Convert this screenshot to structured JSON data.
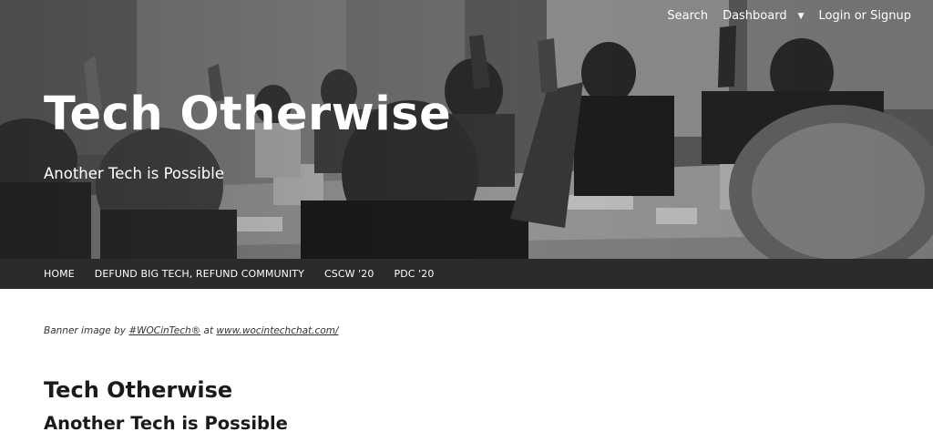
{
  "top_nav": {
    "search_label": "Search",
    "dashboard_label": "Dashboard",
    "login_label": "Login or Signup"
  },
  "header": {
    "site_title": "Tech Otherwise",
    "tagline": "Another Tech is Possible"
  },
  "main_menu": {
    "items": [
      {
        "label": "HOME"
      },
      {
        "label": "DEFUND BIG TECH, REFUND COMMUNITY"
      },
      {
        "label": "CSCW '20"
      },
      {
        "label": "PDC '20"
      }
    ]
  },
  "content": {
    "credit_prefix": "Banner image by ",
    "credit_author": "#WOCinTech®",
    "credit_middle": " at ",
    "credit_link": "www.wocintechchat.com/",
    "title": "Tech Otherwise",
    "subtitle": "Another Tech is Possible"
  },
  "colors": {
    "menu_bar": "#2b2b2b",
    "hero_text": "#ffffff",
    "body_text": "#1a1a1a"
  },
  "icons": {
    "dashboard_dropdown": "caret-down-icon"
  }
}
